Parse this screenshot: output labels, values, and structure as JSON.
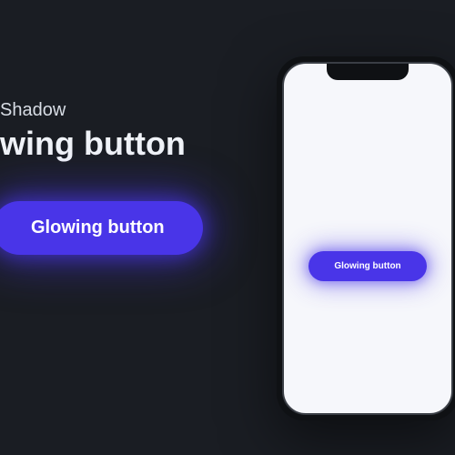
{
  "left": {
    "subtitle": "Shadow",
    "title": "wing button",
    "button_label": "Glowing button"
  },
  "phone": {
    "button_label": "Glowing button"
  },
  "colors": {
    "accent": "#4935e8",
    "background": "#1a1d23",
    "phone_screen": "#f6f7fb"
  }
}
